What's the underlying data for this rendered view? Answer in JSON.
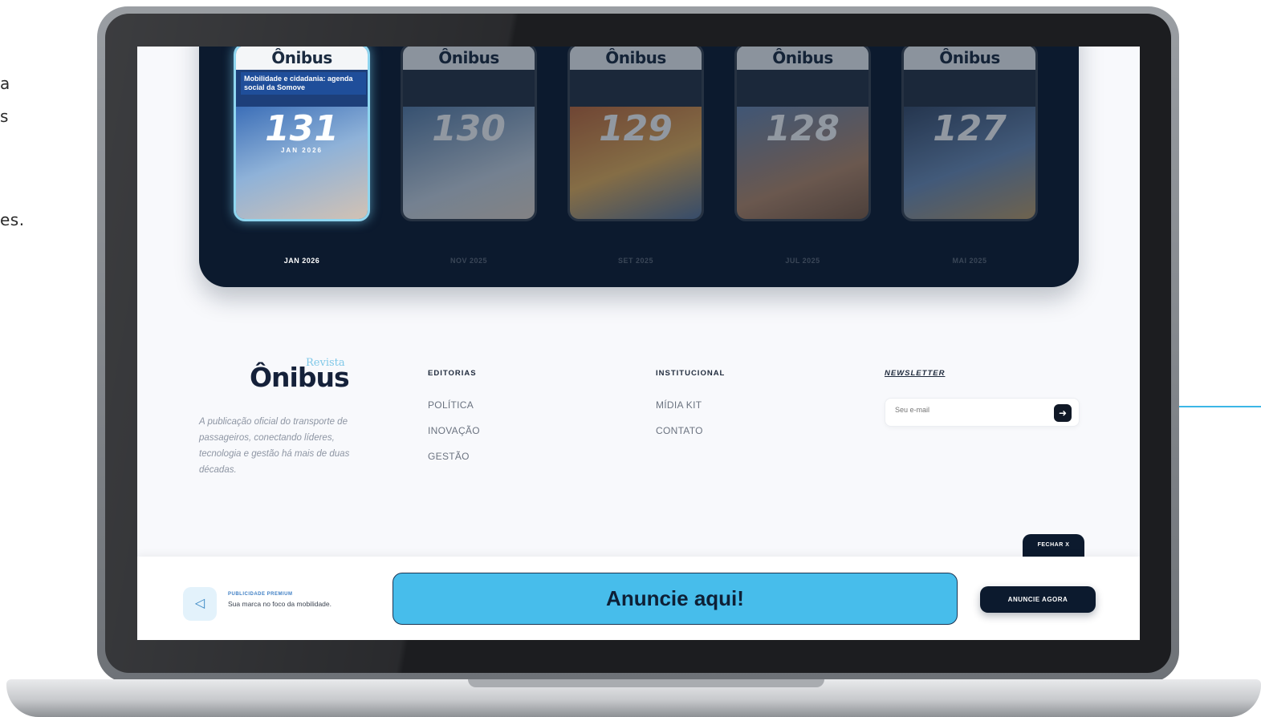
{
  "side_text": [
    "a",
    "s",
    "es."
  ],
  "colors": {
    "accent": "#47bdeb",
    "navy": "#0c1a2e",
    "accent_line": "#3cb7e6"
  },
  "magazines": [
    {
      "brand": "Ônibus",
      "headline": "Mobilidade e cidadania: agenda social da Somove",
      "number": "131",
      "cover_date": "JAN 2026",
      "label": "JAN 2026",
      "active": true
    },
    {
      "brand": "Ônibus",
      "number": "130",
      "label": "NOV 2025",
      "active": false
    },
    {
      "brand": "Ônibus",
      "number": "129",
      "label": "SET 2025",
      "active": false
    },
    {
      "brand": "Ônibus",
      "number": "128",
      "label": "JUL 2025",
      "active": false
    },
    {
      "brand": "Ônibus",
      "number": "127",
      "label": "MAI 2025",
      "active": false
    }
  ],
  "footer": {
    "brand": "Ônibus",
    "brand_sub": "Revista",
    "description": "A publicação oficial do transporte de passageiros, conectando líderes, tecnologia e gestão há mais de duas décadas.",
    "editorias": {
      "heading": "EDITORIAS",
      "links": [
        "POLÍTICA",
        "INOVAÇÃO",
        "GESTÃO"
      ]
    },
    "institucional": {
      "heading": "INSTITUCIONAL",
      "links": [
        "MÍDIA KIT",
        "CONTATO"
      ]
    },
    "newsletter": {
      "heading": "NEWSLETTER",
      "placeholder": "Seu e-mail",
      "submit_icon": "arrow-right-icon"
    }
  },
  "ad_bar": {
    "close_label": "FECHAR X",
    "tag": "PUBLICIDADE PREMIUM",
    "subtitle": "Sua marca no foco da mobilidade.",
    "banner_text": "Anuncie aqui!",
    "cta_label": "ANUNCIE AGORA",
    "icon": "megaphone-icon"
  }
}
